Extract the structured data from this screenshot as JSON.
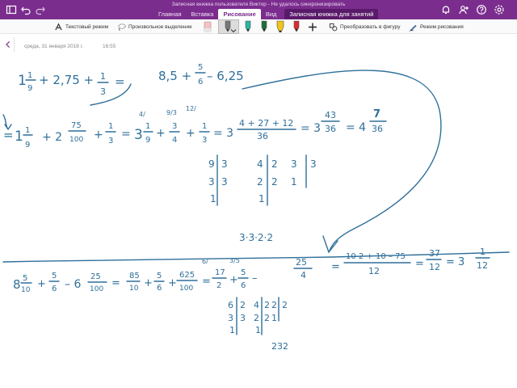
{
  "titlebar": {
    "title": "Записная книжка пользователя Виктор - Не удалось синхронизировать"
  },
  "tabs": [
    {
      "label": "Главная"
    },
    {
      "label": "Вставка"
    },
    {
      "label": "Рисование"
    },
    {
      "label": "Вид"
    },
    {
      "label": "Записная книжка для занятий"
    }
  ],
  "ribbon": {
    "text_mode": "Текстовый режим",
    "lasso": "Произвольное выделение",
    "convert": "Преобразовать в фигуру",
    "draw_mode": "Режим рисования",
    "pen_colors": [
      "#8a8a8a",
      "#2bb5a0",
      "#1b6e3a",
      "#f0c419",
      "#d62d2d"
    ],
    "accent": "#7b2d8e"
  },
  "page": {
    "date": "среда, 31 января 2018 г.",
    "time": "16:55"
  },
  "ink": {
    "l1_a": "1",
    "l1_b": "1",
    "l1_c": "9",
    "l1_d": "+ 2,75 +",
    "l1_e": "1",
    "l1_f": "3",
    "l1_g": "=",
    "l2_a": "8,5 +",
    "l2_b": "5",
    "l2_c": "6",
    "l2_d": "– 6,25",
    "r1_eq": "=",
    "r1_1": "1",
    "r1_2": "1",
    "r1_3": "9",
    "r1_4": "+ 2",
    "r1_5": "75",
    "r1_6": "100",
    "r1_7": "+",
    "r1_8": "1",
    "r1_9": "3",
    "r1_10": "=",
    "r1_11": "3",
    "r1_12": "1",
    "r1_13": "9",
    "r1_14": "+",
    "r1_15": "3",
    "r1_16": "4",
    "r1_17": "+",
    "r1_18": "1",
    "r1_19": "3",
    "r1_20": "= 3",
    "r1_21": "4 + 27 + 12",
    "r1_22": "36",
    "r1_23": "= 3",
    "r1_24": "43",
    "r1_25": "36",
    "r1_26": "= 4",
    "r1_27": "7",
    "r1_28": "36",
    "r1_m1": "4/",
    "r1_m2": "9/3",
    "r1_m3": "12/",
    "f1_rows": [
      [
        "9",
        "3",
        "4",
        "2",
        "3",
        "3"
      ],
      [
        "3",
        "3",
        "2",
        "2",
        "1",
        ""
      ],
      [
        "1",
        "",
        "1",
        "",
        "",
        ""
      ]
    ],
    "f1_prod": "3·3·2·2",
    "r2_1": "8",
    "r2_2": "5",
    "r2_3": "10",
    "r2_4": "+",
    "r2_5": "5",
    "r2_6": "6",
    "r2_7": "– 6",
    "r2_8": "25",
    "r2_9": "100",
    "r2_10": "=",
    "r2_11": "85",
    "r2_12": "10",
    "r2_13": "+",
    "r2_14": "5",
    "r2_15": "6",
    "r2_16": "+",
    "r2_17": "625",
    "r2_18": "100",
    "r2_19": "=",
    "r2_20": "17",
    "r2_21": "2",
    "r2_22": "+",
    "r2_23": "5",
    "r2_24": "6",
    "r2_25": "–",
    "r2_m1": "6/",
    "r2_m2": "3/5",
    "r2_26": "25",
    "r2_27": "4",
    "r2_28": "=",
    "r2_29": "10 2 + 10 – 75",
    "r2_30": "12",
    "r2_31": "=",
    "r2_32": "37",
    "r2_33": "12",
    "r2_34": "= 3",
    "r2_35": "1",
    "r2_36": "12",
    "f2_rows": [
      [
        "6",
        "2",
        "4",
        "2",
        "2",
        "2"
      ],
      [
        "3",
        "3",
        "2",
        "2",
        "1",
        ""
      ],
      [
        "1",
        "",
        "1",
        "",
        "",
        ""
      ]
    ],
    "f2_prod": "232"
  }
}
